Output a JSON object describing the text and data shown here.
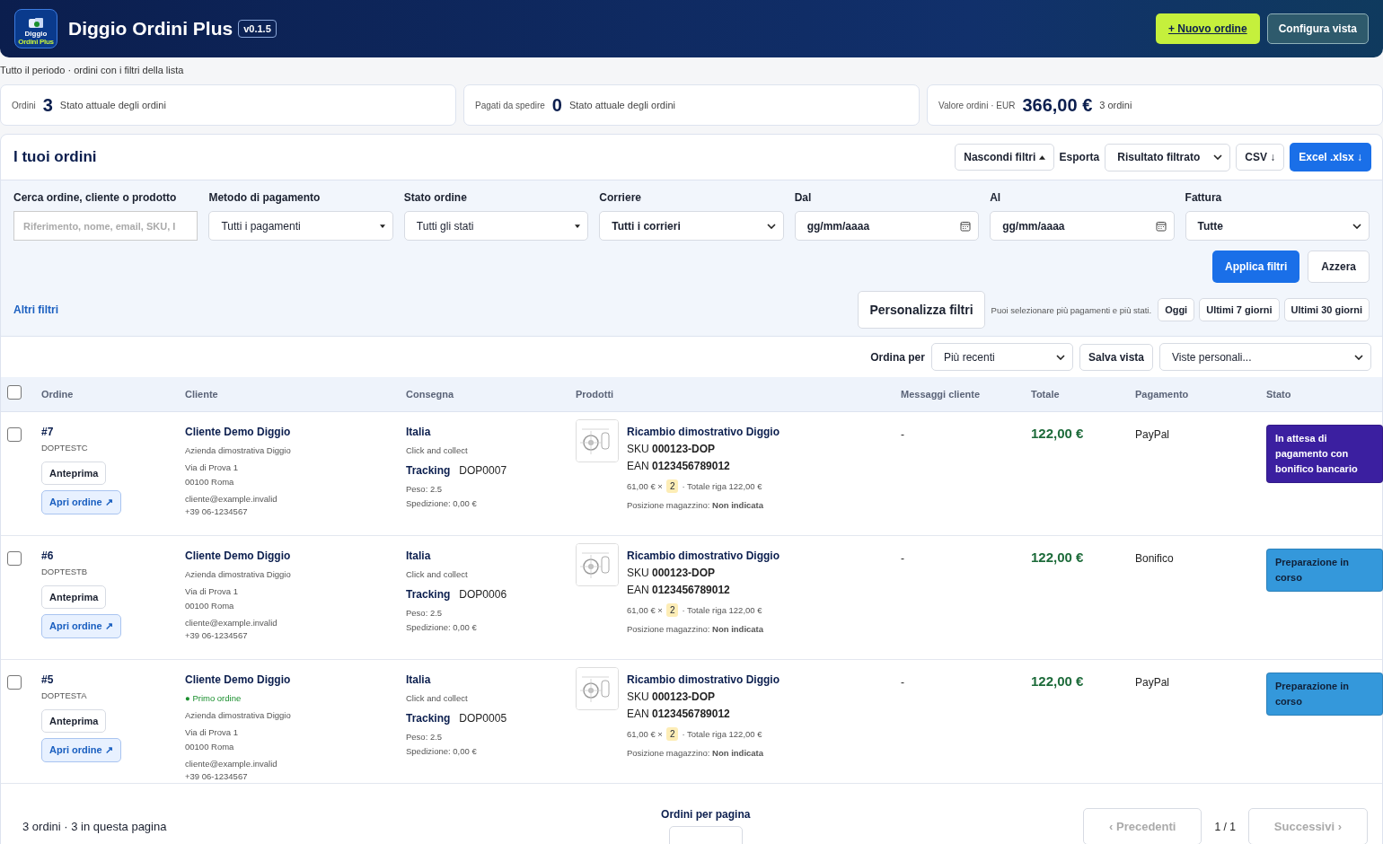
{
  "header": {
    "title": "Diggio Ordini Plus",
    "logo_line1": "Diggio",
    "logo_line2": "Ordini Plus",
    "version": "v0.1.5",
    "new_order": "+ Nuovo ordine",
    "configure": "Configura vista"
  },
  "period_note": "Tutto il periodo · ordini con i filtri della lista",
  "stats": [
    {
      "label": "Ordini",
      "value": "3",
      "note": "Stato attuale degli ordini"
    },
    {
      "label": "Pagati da spedire",
      "value": "0",
      "note": "Stato attuale degli ordini"
    },
    {
      "label": "Valore ordini · EUR",
      "value": "366,00 €",
      "note": "3 ordini"
    }
  ],
  "panel": {
    "title": "I tuoi ordini",
    "hide_filters": "Nascondi filtri",
    "export_label": "Esporta",
    "export_value": "Risultato filtrato",
    "csv": "CSV ↓",
    "excel": "Excel .xlsx ↓"
  },
  "filters": [
    {
      "kind": "input",
      "label": "Cerca ordine, cliente o prodotto",
      "placeholder": "Riferimento, nome, email, SKU, I"
    },
    {
      "kind": "dropdown",
      "label": "Metodo di pagamento",
      "value": "Tutti i pagamenti"
    },
    {
      "kind": "dropdown",
      "label": "Stato ordine",
      "value": "Tutti gli stati"
    },
    {
      "kind": "select",
      "label": "Corriere",
      "value": "Tutti i corrieri"
    },
    {
      "kind": "date",
      "label": "Dal",
      "value": "gg/mm/aaaa"
    },
    {
      "kind": "date",
      "label": "Al",
      "value": "gg/mm/aaaa"
    },
    {
      "kind": "select",
      "label": "Fattura",
      "value": "Tutte"
    }
  ],
  "apply": "Applica filtri",
  "reset": "Azzera",
  "more_filters": "Altri filtri",
  "customize": "Personalizza filtri",
  "hint": "Puoi selezionare più pagamenti e più stati.",
  "quick_ranges": [
    "Oggi",
    "Ultimi 7 giorni",
    "Ultimi 30 giorni"
  ],
  "sort": {
    "label": "Ordina per",
    "value": "Più recenti",
    "save": "Salva vista",
    "views": "Viste personali..."
  },
  "table": {
    "select_all_checked": false,
    "columns": [
      "Ordine",
      "Cliente",
      "Consegna",
      "Prodotti",
      "Messaggi cliente",
      "Totale",
      "Pagamento",
      "Stato"
    ],
    "rows": [
      {
        "checked": false,
        "number": "#7",
        "ref": "DOPTESTC",
        "preview": "Anteprima",
        "open": "Apri ordine ↗",
        "customer": "Cliente Demo Diggio",
        "first_order": null,
        "company": "Azienda dimostrativa Diggio",
        "address1": "Via di Prova 1",
        "address2": "00100 Roma",
        "email": "cliente@example.invalid",
        "phone": "+39 06-1234567",
        "country": "Italia",
        "method": "Click and collect",
        "tracking_label": "Tracking",
        "tracking": "DOP0007",
        "weight": "Peso: 2.5",
        "shipping": "Spedizione: 0,00 €",
        "product": "Ricambio dimostrativo Diggio",
        "sku_label": "SKU",
        "sku": "000123-DOP",
        "ean_label": "EAN",
        "ean": "0123456789012",
        "price": "61,00 € ×",
        "qty": "2",
        "line_total": "· Totale riga 122,00 €",
        "location_label": "Posizione magazzino:",
        "location": "Non indicata",
        "messages": "-",
        "total": "122,00 €",
        "payment": "PayPal",
        "status": "In attesa di pagamento con bonifico bancario",
        "color": "#3b1fa0"
      },
      {
        "checked": false,
        "number": "#6",
        "ref": "DOPTESTB",
        "preview": "Anteprima",
        "open": "Apri ordine ↗",
        "customer": "Cliente Demo Diggio",
        "first_order": null,
        "company": "Azienda dimostrativa Diggio",
        "address1": "Via di Prova 1",
        "address2": "00100 Roma",
        "email": "cliente@example.invalid",
        "phone": "+39 06-1234567",
        "country": "Italia",
        "method": "Click and collect",
        "tracking_label": "Tracking",
        "tracking": "DOP0006",
        "weight": "Peso: 2.5",
        "shipping": "Spedizione: 0,00 €",
        "product": "Ricambio dimostrativo Diggio",
        "sku_label": "SKU",
        "sku": "000123-DOP",
        "ean_label": "EAN",
        "ean": "0123456789012",
        "price": "61,00 € ×",
        "qty": "2",
        "line_total": "· Totale riga 122,00 €",
        "location_label": "Posizione magazzino:",
        "location": "Non indicata",
        "messages": "-",
        "total": "122,00 €",
        "payment": "Bonifico",
        "status": "Preparazione in corso",
        "color": "#3498db"
      },
      {
        "checked": false,
        "number": "#5",
        "ref": "DOPTESTA",
        "preview": "Anteprima",
        "open": "Apri ordine ↗",
        "customer": "Cliente Demo Diggio",
        "first_order": "● Primo ordine",
        "company": "Azienda dimostrativa Diggio",
        "address1": "Via di Prova 1",
        "address2": "00100 Roma",
        "email": "cliente@example.invalid",
        "phone": "+39 06-1234567",
        "country": "Italia",
        "method": "Click and collect",
        "tracking_label": "Tracking",
        "tracking": "DOP0005",
        "weight": "Peso: 2.5",
        "shipping": "Spedizione: 0,00 €",
        "product": "Ricambio dimostrativo Diggio",
        "sku_label": "SKU",
        "sku": "000123-DOP",
        "ean_label": "EAN",
        "ean": "0123456789012",
        "price": "61,00 € ×",
        "qty": "2",
        "line_total": "· Totale riga 122,00 €",
        "location_label": "Posizione magazzino:",
        "location": "Non indicata",
        "messages": "-",
        "total": "122,00 €",
        "payment": "PayPal",
        "status": "Preparazione in corso",
        "color": "#3498db"
      }
    ]
  },
  "footer": {
    "count": "3 ordini · 3 in questa pagina",
    "per_page_label": "Ordini per pagina",
    "prev": "‹ Precedenti",
    "page": "1 / 1",
    "next": "Successivi ›"
  }
}
